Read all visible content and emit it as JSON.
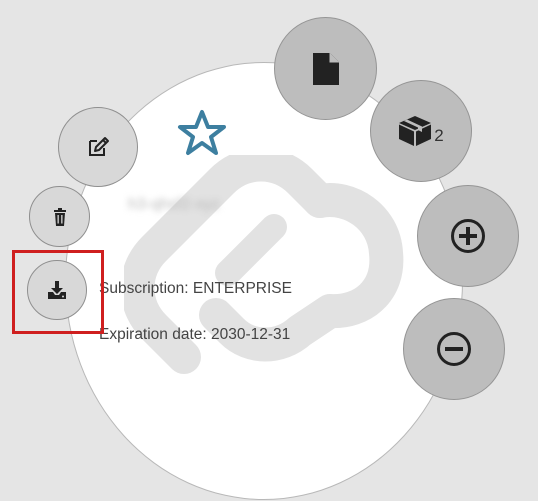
{
  "license": {
    "name": "h3-qhsf2-xyz",
    "subscription": "Subscription: ENTERPRISE",
    "expiration": "Expiration date: 2030-12-31"
  },
  "package_count": "2",
  "icons": {
    "favorite": "star-icon",
    "edit": "pencil-square-icon",
    "delete": "trash-icon",
    "download": "download-tray-icon",
    "file": "file-icon",
    "package": "package-box-icon",
    "add": "plus-circle-icon",
    "remove": "minus-circle-icon",
    "watermark": "brand-logo-watermark"
  },
  "colors": {
    "background": "#e5e5e5",
    "card": "#ffffff",
    "star": "#3d7fa0",
    "button_light": "#d8d8d8",
    "button_dark": "#bdbdbd",
    "highlight": "#cf1f1f",
    "text": "#444444"
  }
}
